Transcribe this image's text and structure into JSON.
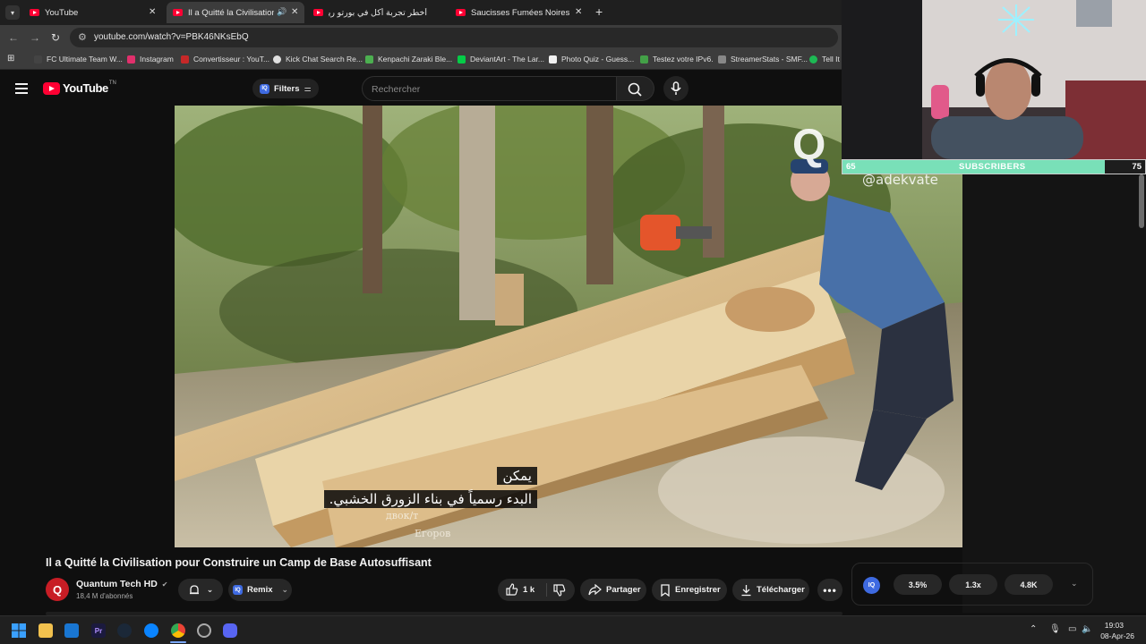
{
  "browser": {
    "tabs": [
      {
        "label": "YouTube",
        "active": false
      },
      {
        "label": "Il a Quitté la Civilisation po",
        "active": true,
        "audio": true
      },
      {
        "label": "أخطر تجربة أكل في بورتو ريكو...",
        "active": false
      },
      {
        "label": "Saucisses Fumées Noires Bushi",
        "active": false
      }
    ],
    "url": "youtube.com/watch?v=PBK46NKsEbQ",
    "bookmarks": [
      {
        "label": "FC Ultimate Team W...",
        "color": "#444"
      },
      {
        "label": "Instagram",
        "color": "#e1306c"
      },
      {
        "label": "Convertisseur : YouT...",
        "color": "#c62828"
      },
      {
        "label": "Kick Chat Search Re...",
        "color": "#e0e0e0"
      },
      {
        "label": "Kenpachi Zaraki Ble...",
        "color": "#4caf50"
      },
      {
        "label": "DeviantArt - The Lar...",
        "color": "#05cc47"
      },
      {
        "label": "Photo Quiz - Guess...",
        "color": "#f1f1f1"
      },
      {
        "label": "Testez votre IPv6.",
        "color": "#43a047"
      },
      {
        "label": "StreamerStats - SMF...",
        "color": "#888"
      },
      {
        "label": "Tell It",
        "color": "#1db954"
      }
    ]
  },
  "youtube": {
    "logo_text": "YouTube",
    "logo_suffix": "TN",
    "filters_label": "Filters",
    "filters_badge": "IQ",
    "search_placeholder": "Rechercher"
  },
  "video": {
    "subtitle_line1": "يمكن",
    "subtitle_line2": "البدء رسمياً في بناء الزورق الخشبي.",
    "watermark_handle": "@adekvate",
    "watermark_cyrillic_1": "двок/т",
    "watermark_cyrillic_2": "Егоров",
    "title": "Il a Quitté la Civilisation pour Construire un Camp de Base Autosuffisant",
    "channel": "Quantum Tech HD",
    "channel_initial": "Q",
    "subscribers": "18,4 M d'abonnés",
    "remix_label": "Remix",
    "remix_badge": "IQ",
    "likes": "1 k",
    "share_label": "Partager",
    "save_label": "Enregistrer",
    "download_label": "Télécharger"
  },
  "stream_overlay": {
    "subs_current": "65",
    "subs_label": "SUBSCRIBERS",
    "subs_goal": "75",
    "subs_progress": 0.867
  },
  "stats": {
    "badge": "IQ",
    "values": [
      "3.5%",
      "1.3x",
      "4.8K"
    ]
  },
  "taskbar": {
    "time": "19:03",
    "date": "08-Apr-26"
  },
  "colors": {
    "youtube_red": "#ff0033",
    "accent_blue": "#3e6ae1",
    "subs_bar": "#79e0b8"
  }
}
